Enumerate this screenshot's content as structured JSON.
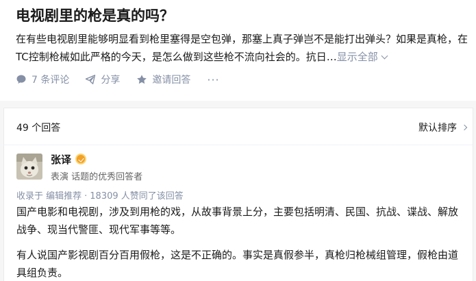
{
  "question": {
    "title": "电视剧里的枪是真的吗？",
    "detail": "在有些电视剧里能够明显看到枪里塞得是空包弹，那塞上真子弹岂不是能打出弹头？如果是真枪，在TC控制枪械如此严格的今天，是怎么做到这些枪不流向社会的。抗日…",
    "show_all": "显示全部",
    "actions": {
      "comments": "7 条评论",
      "share": "分享",
      "invite": "邀请回答",
      "more": "···"
    }
  },
  "answers": {
    "count_label": "49 个回答",
    "sort_label": "默认排序",
    "item": {
      "author_name": "张译",
      "author_headline": "表演 话题的优秀回答者",
      "meta": {
        "collected_by": "收录于 编辑推荐",
        "separator": "·",
        "upvotes": "18309 人赞同了该回答"
      },
      "paragraphs": [
        "国产电影和电视剧，涉及到用枪的戏，从故事背景上分，主要包括明清、民国、抗战、谍战、解放战争、现当代警匪、现代军事等等。",
        "有人说国产影视剧百分百用假枪，这是不正确的。事实是真假参半，真枪归枪械组管理，假枪由道具组负责。"
      ]
    }
  },
  "colors": {
    "text": "#1a1a1a",
    "secondary": "#8590a6",
    "badge": "#f1a128",
    "background": "#f6f6f6"
  }
}
